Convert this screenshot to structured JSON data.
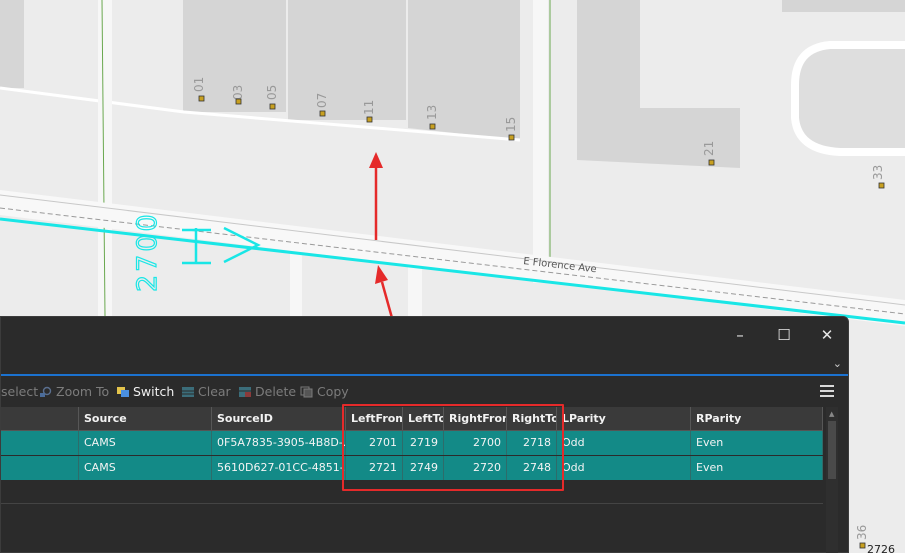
{
  "map": {
    "street_label": "E Florence Ave",
    "range_label": "2700",
    "addresses": [
      "01",
      "03",
      "05",
      "07",
      "11",
      "13",
      "15",
      "21",
      "33"
    ],
    "bottom_addresses": [
      "36",
      "2726"
    ],
    "colors": {
      "road_highlight": "#19e6e6",
      "annotation": "#e52a2a",
      "parcel": "#d5d5d5"
    }
  },
  "window": {
    "buttons": {
      "minimize": "–",
      "maximize": "☐",
      "close": "✕"
    }
  },
  "toolbar": {
    "items": [
      {
        "label": "select",
        "enabled": false
      },
      {
        "label": "Zoom To",
        "enabled": false
      },
      {
        "label": "Switch",
        "enabled": true
      },
      {
        "label": "Clear",
        "enabled": false
      },
      {
        "label": "Delete",
        "enabled": false
      },
      {
        "label": "Copy",
        "enabled": false
      }
    ]
  },
  "table": {
    "columns": [
      "Source",
      "SourceID",
      "LeftFrom",
      "LeftTo",
      "RightFrom",
      "RightTo",
      "LParity",
      "RParity"
    ],
    "rows": [
      [
        "CAMS",
        "0F5A7835-3905-4B8D-...",
        "2701",
        "2719",
        "2700",
        "2718",
        "Odd",
        "Even"
      ],
      [
        "CAMS",
        "5610D627-01CC-4851-...",
        "2721",
        "2749",
        "2720",
        "2748",
        "Odd",
        "Even"
      ]
    ]
  }
}
